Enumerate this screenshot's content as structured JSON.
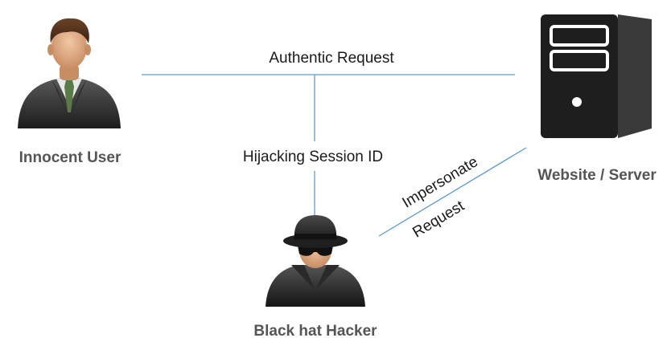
{
  "nodes": {
    "user": {
      "label": "Innocent User",
      "icon": "businessman-icon"
    },
    "server": {
      "label": "Website / Server",
      "icon": "server-tower-icon"
    },
    "hacker": {
      "label": "Black hat Hacker",
      "icon": "spy-hacker-icon"
    }
  },
  "edges": {
    "authentic": {
      "label": "Authentic Request"
    },
    "hijack": {
      "label": "Hijacking Session ID"
    },
    "impersonate": {
      "line1": "Impersonate",
      "line2": "Request"
    }
  },
  "colors": {
    "connector": "#5b9bd5",
    "node_label": "#555555",
    "edge_label": "#1a1a1a",
    "server_body": "#1e1e1e"
  }
}
